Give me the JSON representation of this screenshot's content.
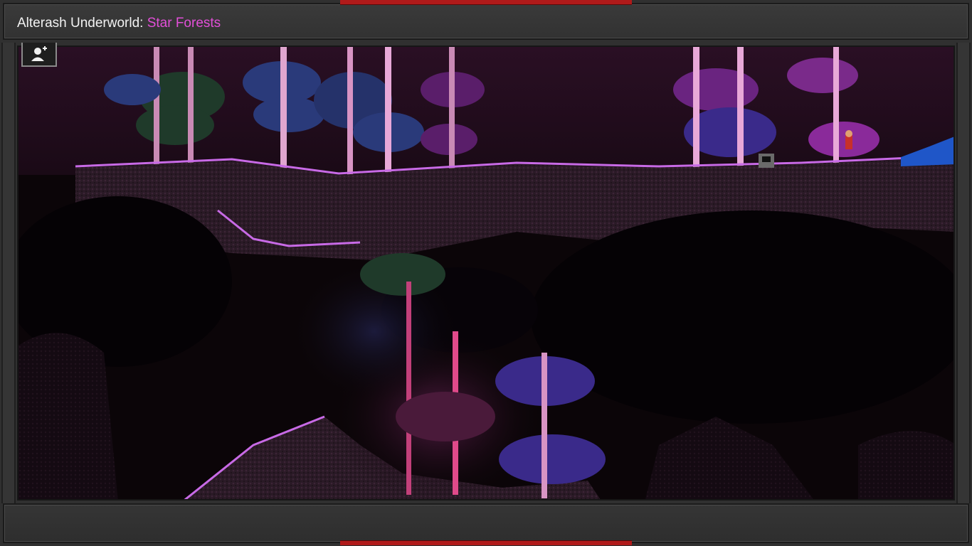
{
  "planet": {
    "name_prefix": "Alterash Underworld:",
    "biome": "Star Forests"
  },
  "colors": {
    "biome_text": "#e24fd8",
    "frame_red": "#b01a1a",
    "tree_pink": "#e8a8d8",
    "foliage_purple": "#7a2a8a",
    "foliage_blue": "#2a3a7a",
    "foliage_green": "#1f3a2a",
    "crystal": "#c86ae6",
    "water": "#1f56c8"
  },
  "icons": {
    "beam_button": "character-beam-icon"
  }
}
